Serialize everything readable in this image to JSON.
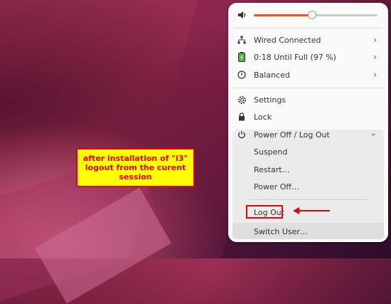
{
  "annotation": {
    "lines": [
      "after installation of \"i3\"",
      "logout from the curent",
      "session"
    ],
    "colors": {
      "background": "#ffff00",
      "text": "#e60000",
      "border": "#e60000"
    }
  },
  "menu": {
    "volume": {
      "icon": "speaker-icon",
      "level_fraction": 0.47,
      "accent": "#e95420"
    },
    "items": [
      {
        "label": "Wired Connected",
        "icon": "network-icon",
        "has_chevron": true
      },
      {
        "label": "0:18 Until Full (97 %)",
        "icon": "battery-charging-icon",
        "has_chevron": true
      },
      {
        "label": "Balanced",
        "icon": "power-mode-icon",
        "has_chevron": true
      },
      {
        "label": "Settings",
        "icon": "gear-icon"
      },
      {
        "label": "Lock",
        "icon": "lock-icon"
      },
      {
        "label": "Power Off / Log Out",
        "icon": "power-icon",
        "expanded": true
      }
    ],
    "power_submenu": [
      "Suspend",
      "Restart…",
      "Power Off…",
      "Log Out",
      "Switch User…"
    ],
    "highlight_color": "#e60000"
  }
}
